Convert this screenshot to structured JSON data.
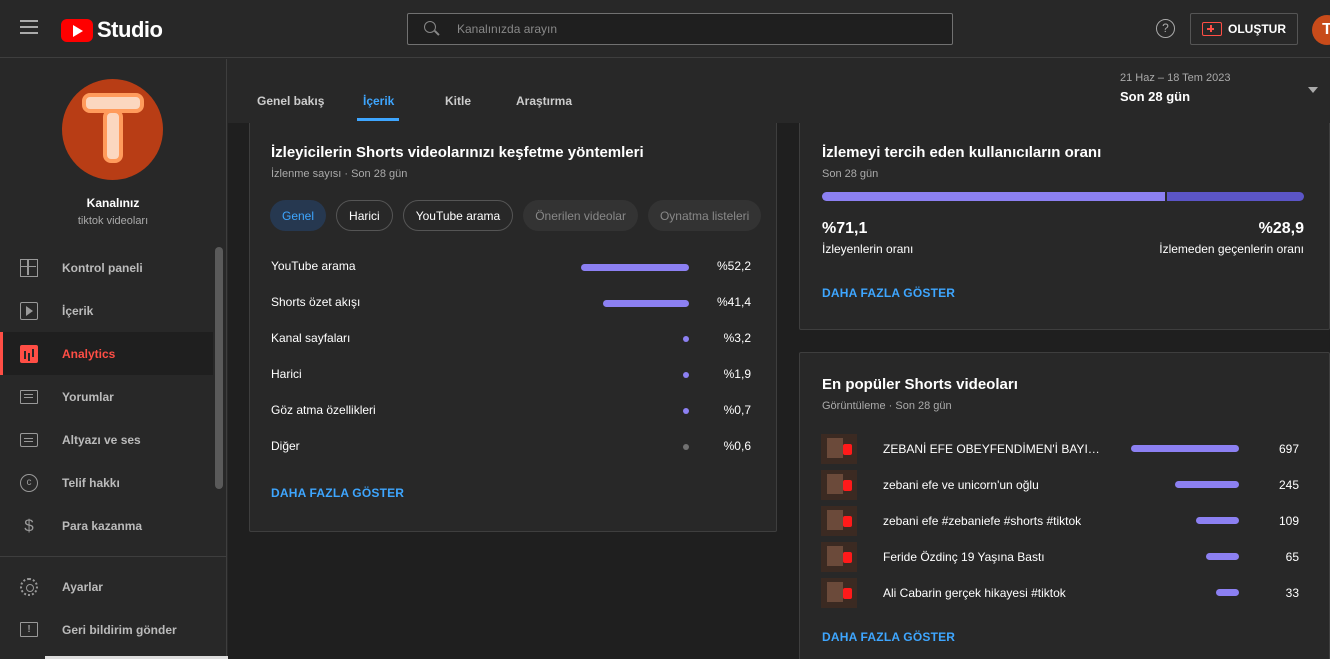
{
  "app": {
    "logo_text": "Studio"
  },
  "search": {
    "placeholder": "Kanalınızda arayın"
  },
  "header": {
    "help_icon": "?",
    "create_label": "OLUŞTUR",
    "avatar_letter": "T"
  },
  "channel": {
    "name": "Kanalınız",
    "subtitle": "tiktok videoları"
  },
  "sidebar": {
    "items": [
      {
        "label": "Kontrol paneli",
        "icon": "dashboard-icon"
      },
      {
        "label": "İçerik",
        "icon": "content-icon"
      },
      {
        "label": "Analytics",
        "icon": "analytics-icon",
        "active": true
      },
      {
        "label": "Yorumlar",
        "icon": "comments-icon"
      },
      {
        "label": "Altyazı ve ses",
        "icon": "subtitles-icon"
      },
      {
        "label": "Telif hakkı",
        "icon": "copyright-icon"
      },
      {
        "label": "Para kazanma",
        "icon": "monetization-icon"
      }
    ],
    "bottom_items": [
      {
        "label": "Ayarlar",
        "icon": "settings-icon"
      },
      {
        "label": "Geri bildirim gönder",
        "icon": "feedback-icon"
      }
    ],
    "copyright_glyph": "c",
    "dollar_glyph": "$",
    "flag_glyph": "!"
  },
  "tabs": [
    {
      "label": "Genel bakış"
    },
    {
      "label": "İçerik",
      "active": true
    },
    {
      "label": "Kitle"
    },
    {
      "label": "Araştırma"
    }
  ],
  "date_range": {
    "range": "21 Haz – 18 Tem 2023",
    "label": "Son 28 gün"
  },
  "discovery_card": {
    "title": "İzleyicilerin Shorts videolarınızı keşfetme yöntemleri",
    "subtitle": "İzlenme sayısı · Son 28 gün",
    "chips": [
      {
        "label": "Genel",
        "state": "selected"
      },
      {
        "label": "Harici",
        "state": "outline"
      },
      {
        "label": "YouTube arama",
        "state": "outline"
      },
      {
        "label": "Önerilen videolar",
        "state": "disabled"
      },
      {
        "label": "Oynatma listeleri",
        "state": "disabled"
      }
    ],
    "rows": [
      {
        "label": "YouTube arama",
        "value": "%52,2",
        "percent": 52.2
      },
      {
        "label": "Shorts özet akışı",
        "value": "%41,4",
        "percent": 41.4
      },
      {
        "label": "Kanal sayfaları",
        "value": "%3,2",
        "percent": 3.2
      },
      {
        "label": "Harici",
        "value": "%1,9",
        "percent": 1.9
      },
      {
        "label": "Göz atma özellikleri",
        "value": "%0,7",
        "percent": 0.7
      },
      {
        "label": "Diğer",
        "value": "%0,6",
        "percent": 0.6,
        "muted": true
      }
    ],
    "more_link": "DAHA FAZLA GÖSTER",
    "bar_color": "#8c80f2",
    "muted_color": "#717171"
  },
  "ratio_card": {
    "title": "İzlemeyi tercih eden kullanıcıların oranı",
    "subtitle": "Son 28 gün",
    "watched_value": "%71,1",
    "watched_label": "İzleyenlerin oranı",
    "skipped_value": "%28,9",
    "skipped_label": "İzlemeden geçenlerin oranı",
    "watched_fraction": 0.711,
    "more_link": "DAHA FAZLA GÖSTER",
    "watched_color": "#8c80f2",
    "skipped_color": "#5b55c7"
  },
  "top_shorts_card": {
    "title": "En popüler Shorts videoları",
    "subtitle": "Görüntüleme · Son 28 gün",
    "videos": [
      {
        "title": "ZEBANİ EFE OBEYFENDİMEN'İ BAYILTIY...",
        "views": "697",
        "count": 697
      },
      {
        "title": "zebani efe ve unicorn'un oğlu",
        "views": "245",
        "count": 245
      },
      {
        "title": "zebani efe #zebaniefe #shorts #tiktok",
        "views": "109",
        "count": 109
      },
      {
        "title": "Feride Özdinç 19 Yaşına Bastı",
        "views": "65",
        "count": 65
      },
      {
        "title": "Ali Cabarin gerçek hikayesi #tiktok",
        "views": "33",
        "count": 33
      }
    ],
    "more_link": "DAHA FAZLA GÖSTER"
  }
}
